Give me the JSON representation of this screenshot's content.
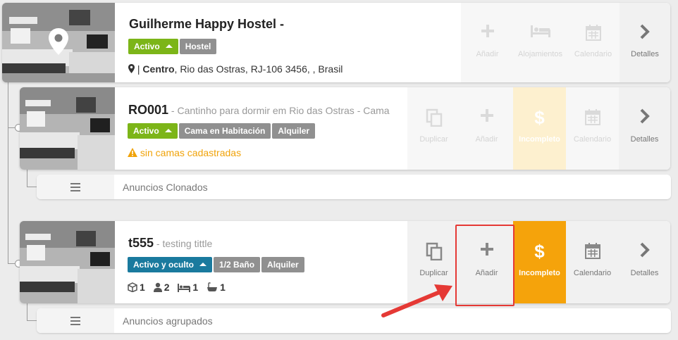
{
  "hostel": {
    "name": "Guilherme Happy Hostel -",
    "status": "Activo",
    "type": "Hostel",
    "address_prefix": "|",
    "address_area": "Centro",
    "address_rest": ", Rio das Ostras, RJ-106 3456, , Brasil",
    "actions": {
      "add": "Añadir",
      "rooms": "Alojamientos",
      "calendar": "Calendario",
      "details": "Detalles"
    }
  },
  "listing1": {
    "code": "RO001",
    "subtitle": " - Cantinho para dormir em Rio das Ostras - Cama",
    "status": "Activo",
    "type": "Cama en Habitación",
    "mode": "Alquiler",
    "warning": "sin camas cadastradas",
    "actions": {
      "duplicate": "Duplicar",
      "add": "Añadir",
      "price": "Incompleto",
      "calendar": "Calendario",
      "details": "Detalles"
    },
    "sub_label": "Anuncios Clonados"
  },
  "listing2": {
    "code": "t555",
    "subtitle": " - testing tittle",
    "status": "Activo y oculto",
    "type": "1/2 Baño",
    "mode": "Alquiler",
    "stats": {
      "rooms": "1",
      "guests": "2",
      "beds": "1",
      "baths": "1"
    },
    "actions": {
      "duplicate": "Duplicar",
      "add": "Añadir",
      "price": "Incompleto",
      "calendar": "Calendario",
      "details": "Detalles"
    },
    "sub_label": "Anuncios agrupados"
  },
  "colors": {
    "green": "#7cb518",
    "blue": "#1a7a9e",
    "amber": "#f5a30b",
    "annotation": "#e53935"
  },
  "icons": [
    "map-pin-icon",
    "plus-icon",
    "bed-icon",
    "calendar-icon",
    "chevron-right-icon",
    "copy-icon",
    "dollar-icon",
    "warning-icon",
    "menu-icon",
    "box-icon",
    "user-icon",
    "bath-icon"
  ]
}
